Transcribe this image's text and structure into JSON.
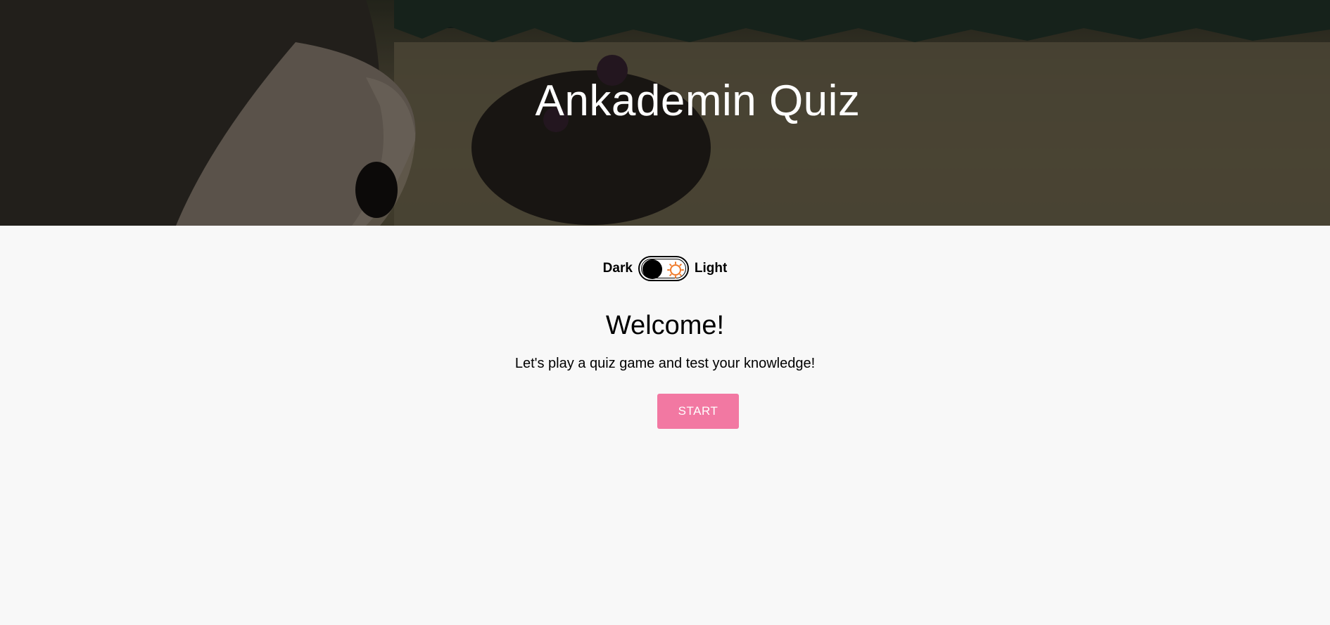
{
  "hero": {
    "title": "Ankademin Quiz"
  },
  "theme_switch": {
    "dark_label": "Dark",
    "light_label": "Light",
    "knob_icon": "moon-knob",
    "light_icon": "sun-icon",
    "sun_color": "#f07a2a"
  },
  "main": {
    "heading": "Welcome!",
    "subtitle": "Let's play a quiz game and test your knowledge!",
    "start_label": "START",
    "start_color": "#f278a2"
  }
}
